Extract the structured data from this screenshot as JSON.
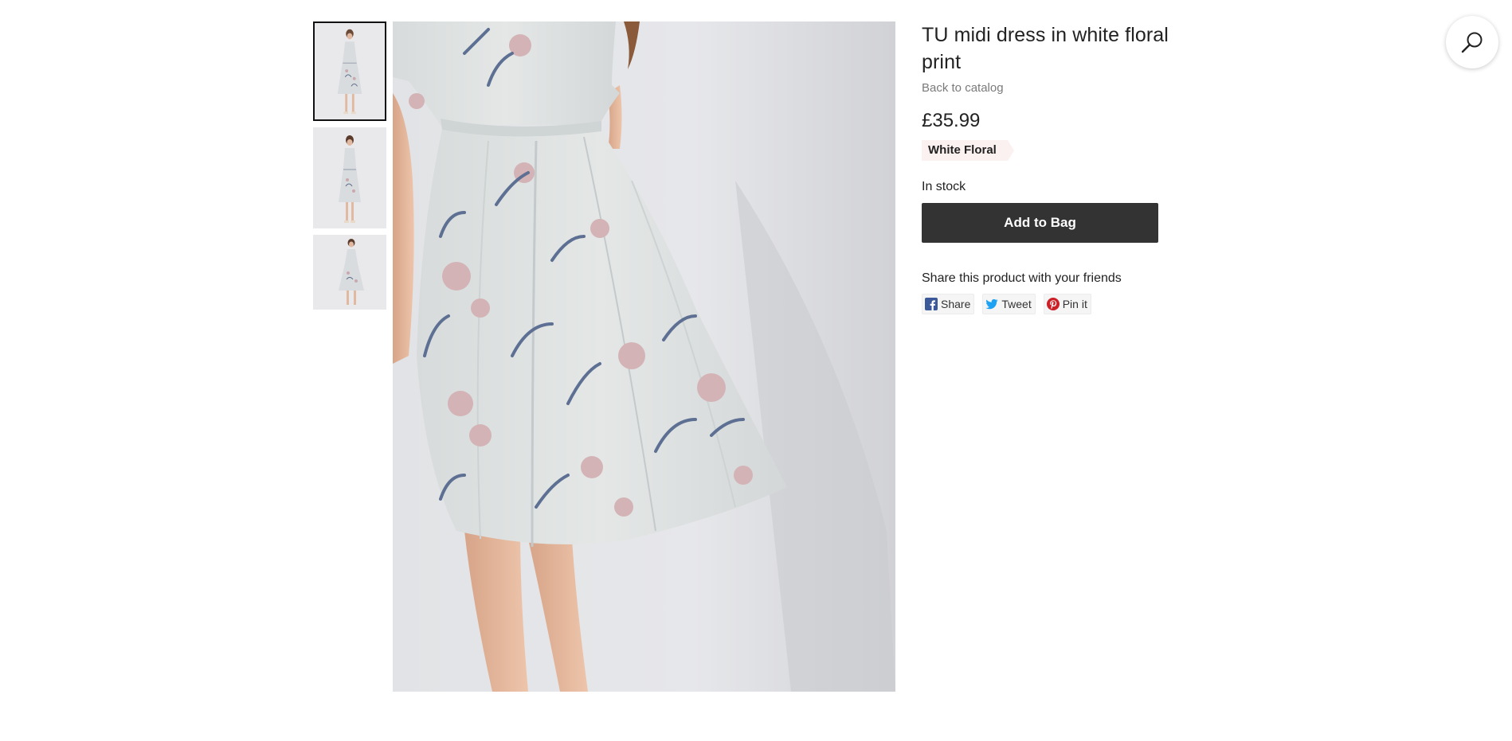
{
  "product": {
    "title": "TU midi dress in white floral print",
    "back_link": "Back to catalog",
    "price": "£35.99",
    "variant": "White Floral",
    "stock_status": "In stock",
    "add_to_bag_label": "Add to Bag"
  },
  "gallery": {
    "thumbnails": [
      {
        "name": "dress-front",
        "selected": true
      },
      {
        "name": "dress-side",
        "selected": false
      },
      {
        "name": "dress-walking",
        "selected": false
      }
    ]
  },
  "share": {
    "heading": "Share this product with your friends",
    "buttons": [
      {
        "label": "Share",
        "icon": "facebook-icon",
        "color": "#3b5998"
      },
      {
        "label": "Tweet",
        "icon": "twitter-icon",
        "color": "#1da1f2"
      },
      {
        "label": "Pin it",
        "icon": "pinterest-icon",
        "color": "#cb2027"
      }
    ]
  },
  "search": {
    "icon": "search-icon"
  },
  "colors": {
    "button_bg": "#333333",
    "tag_bg": "#fbf1f1",
    "muted_text": "#7a7a7a"
  }
}
